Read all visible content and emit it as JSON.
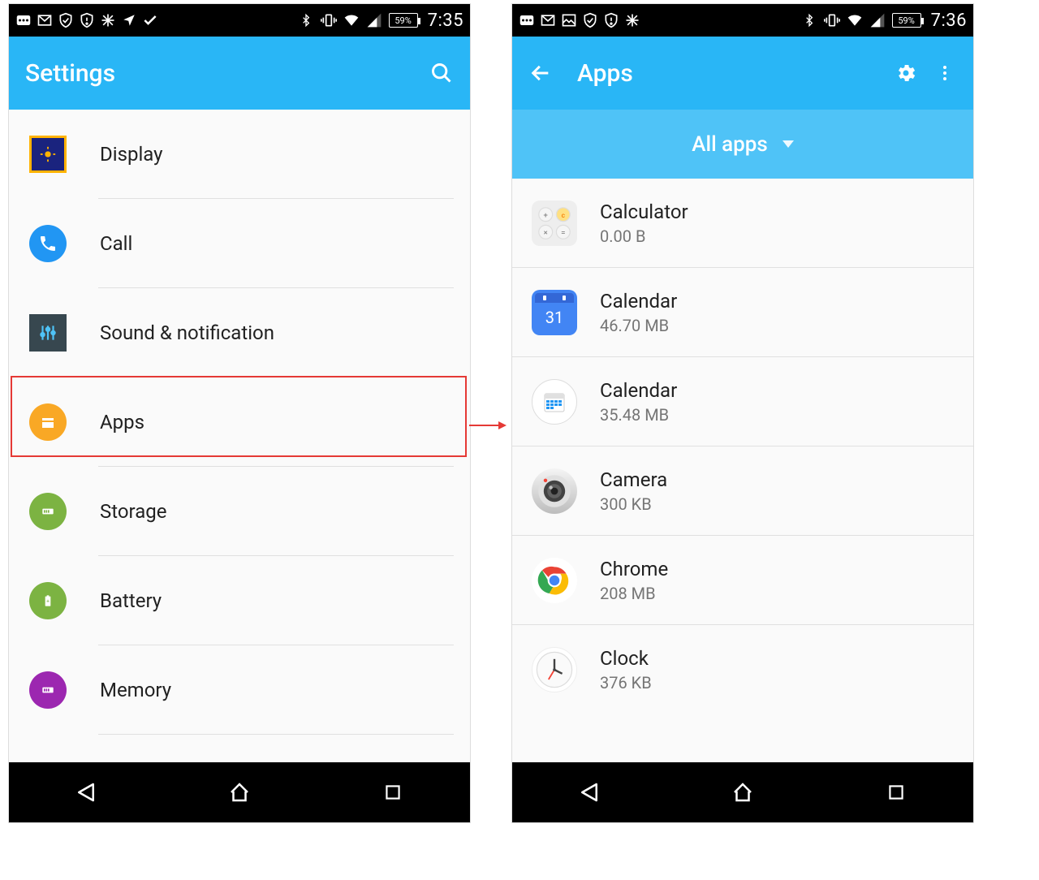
{
  "left": {
    "status": {
      "battery": "59%",
      "time": "7:35"
    },
    "appbar": {
      "title": "Settings"
    },
    "items": [
      {
        "label": "Display"
      },
      {
        "label": "Call"
      },
      {
        "label": "Sound & notification"
      },
      {
        "label": "Apps"
      },
      {
        "label": "Storage"
      },
      {
        "label": "Battery"
      },
      {
        "label": "Memory"
      }
    ],
    "highlighted_index": 3
  },
  "right": {
    "status": {
      "battery": "59%",
      "time": "7:36"
    },
    "appbar": {
      "title": "Apps"
    },
    "filter": {
      "label": "All apps"
    },
    "apps": [
      {
        "name": "Calculator",
        "size": "0.00 B"
      },
      {
        "name": "Calendar",
        "size": "46.70 MB"
      },
      {
        "name": "Calendar",
        "size": "35.48 MB"
      },
      {
        "name": "Camera",
        "size": "300 KB"
      },
      {
        "name": "Chrome",
        "size": "208 MB"
      },
      {
        "name": "Clock",
        "size": "376 KB"
      }
    ]
  }
}
